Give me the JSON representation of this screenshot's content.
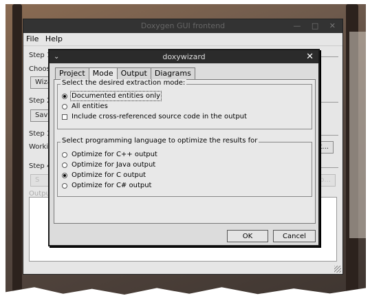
{
  "main_window": {
    "title": "Doxygen GUI frontend",
    "menu": [
      "File",
      "Help"
    ],
    "steps": [
      "Step 1",
      "Step 2",
      "Step 3",
      "Step 4"
    ],
    "choose_label": "Choos",
    "working_label": "Workin",
    "wizard_btn": "Wiza",
    "save_btn": "Sav",
    "select_btn": "ct...",
    "run_btn": "S",
    "browse_btn": "p...",
    "output_label": "Outpu"
  },
  "dialog": {
    "title": "doxywizard",
    "tabs": [
      "Project",
      "Mode",
      "Output",
      "Diagrams"
    ],
    "active_tab": "Mode",
    "extraction_group": {
      "title": "Select the desired extraction mode:",
      "options": [
        "Documented entities only",
        "All entities"
      ],
      "selected": "Documented entities only",
      "checkbox_label": "Include cross-referenced source code in the output",
      "checkbox_checked": false
    },
    "language_group": {
      "title": "Select programming language to optimize the results for",
      "options": [
        "Optimize for C++ output",
        "Optimize for Java output",
        "Optimize for C output",
        "Optimize for C# output"
      ],
      "selected": "Optimize for C output"
    },
    "ok_label": "OK",
    "cancel_label": "Cancel"
  },
  "colors": {
    "titlebar": "#2b2b2b",
    "dialog_bg": "#dcdcdc",
    "panel_bg": "#e8e8e8"
  }
}
